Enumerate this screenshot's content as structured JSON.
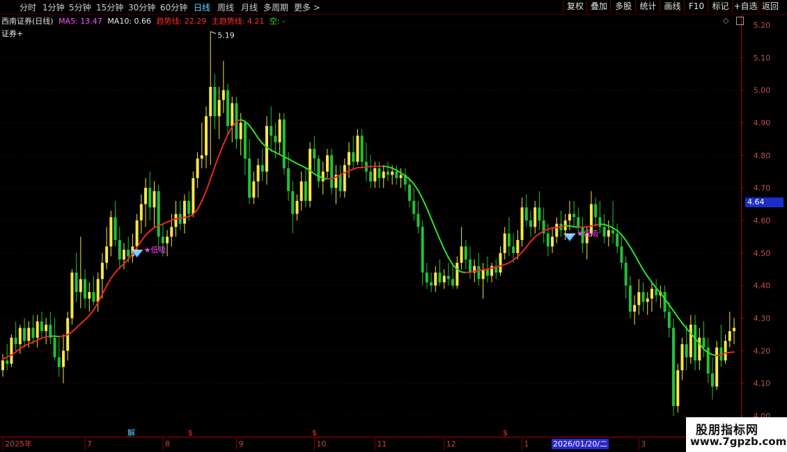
{
  "toolbar": {
    "tabs": [
      {
        "label": "分时"
      },
      {
        "label": "1分钟"
      },
      {
        "label": "5分钟"
      },
      {
        "label": "15分钟"
      },
      {
        "label": "30分钟"
      },
      {
        "label": "60分钟"
      },
      {
        "label": "日线",
        "active": true
      },
      {
        "label": "周线"
      },
      {
        "label": "月线"
      },
      {
        "label": "多周期"
      },
      {
        "label": "更多 >"
      }
    ],
    "right_buttons": [
      {
        "label": "复权"
      },
      {
        "label": "叠加"
      },
      {
        "label": "多股"
      },
      {
        "label": "统计"
      },
      {
        "label": "画线"
      },
      {
        "label": "F10"
      },
      {
        "label": "标记"
      },
      {
        "label": "+自选"
      },
      {
        "label": "返回"
      }
    ]
  },
  "info": {
    "title": "西南证券(日线)",
    "ma5": "MA5: 13.47",
    "ma10": "MA10: 0.66",
    "trend": "趋势线: 22.29",
    "main_trend": "主趋势线: 4.21",
    "empty": "空: -",
    "sublabel": "证券+"
  },
  "price_tag": "4.64",
  "date_box": "2026/01/20/二",
  "markers": {
    "jie": "解",
    "dollar": "$",
    "buy_label": "低吸",
    "high_label": "5.19"
  },
  "colors": {
    "bg": "#000000",
    "up": "#f5e64a",
    "down": "#22c038",
    "trend_up": "#e82828",
    "trend_down": "#30e030",
    "grid": "#6a0000",
    "accent": "#5fd7ff"
  },
  "watermark": {
    "line1": "股朋指标网",
    "line2": "www.7gpzb.com"
  },
  "chart_data": {
    "type": "candlestick",
    "y_axis": {
      "range": [
        4.0,
        5.2
      ],
      "ticks": [
        "5.20",
        "5.10",
        "5.00",
        "4.90",
        "4.80",
        "4.70",
        "4.60",
        "4.50",
        "4.40",
        "4.30",
        "4.20",
        "4.10",
        "4.00"
      ]
    },
    "x_axis": {
      "labels": [
        {
          "text": "2025年",
          "i": 0
        },
        {
          "text": "7",
          "i": 19
        },
        {
          "text": "8",
          "i": 37
        },
        {
          "text": "9",
          "i": 54
        },
        {
          "text": "10",
          "i": 72
        },
        {
          "text": "11",
          "i": 86
        },
        {
          "text": "12",
          "i": 102
        },
        {
          "text": "1",
          "i": 120
        },
        {
          "text": "3",
          "i": 147
        }
      ]
    },
    "annotations": [
      {
        "type": "high",
        "text": "5.19",
        "i": 48,
        "price": 5.18
      },
      {
        "type": "buy",
        "text": "低吸",
        "i": 31,
        "price": 4.5
      },
      {
        "type": "buy",
        "text": "低吸",
        "i": 131,
        "price": 4.55
      }
    ],
    "candles": [
      {
        "o": 4.14,
        "h": 4.19,
        "l": 4.12,
        "c": 4.17
      },
      {
        "o": 4.17,
        "h": 4.22,
        "l": 4.14,
        "c": 4.16
      },
      {
        "o": 4.16,
        "h": 4.25,
        "l": 4.15,
        "c": 4.24
      },
      {
        "o": 4.24,
        "h": 4.29,
        "l": 4.2,
        "c": 4.22
      },
      {
        "o": 4.22,
        "h": 4.28,
        "l": 4.19,
        "c": 4.27
      },
      {
        "o": 4.27,
        "h": 4.3,
        "l": 4.21,
        "c": 4.23
      },
      {
        "o": 4.23,
        "h": 4.29,
        "l": 4.21,
        "c": 4.27
      },
      {
        "o": 4.27,
        "h": 4.31,
        "l": 4.22,
        "c": 4.24
      },
      {
        "o": 4.24,
        "h": 4.31,
        "l": 4.21,
        "c": 4.29
      },
      {
        "o": 4.29,
        "h": 4.32,
        "l": 4.24,
        "c": 4.26
      },
      {
        "o": 4.26,
        "h": 4.3,
        "l": 4.22,
        "c": 4.28
      },
      {
        "o": 4.28,
        "h": 4.32,
        "l": 4.22,
        "c": 4.24
      },
      {
        "o": 4.24,
        "h": 4.3,
        "l": 4.17,
        "c": 4.18
      },
      {
        "o": 4.18,
        "h": 4.24,
        "l": 4.12,
        "c": 4.15
      },
      {
        "o": 4.15,
        "h": 4.25,
        "l": 4.1,
        "c": 4.2
      },
      {
        "o": 4.2,
        "h": 4.32,
        "l": 4.17,
        "c": 4.3
      },
      {
        "o": 4.3,
        "h": 4.45,
        "l": 4.28,
        "c": 4.44
      },
      {
        "o": 4.44,
        "h": 4.5,
        "l": 4.35,
        "c": 4.38
      },
      {
        "o": 4.38,
        "h": 4.55,
        "l": 4.33,
        "c": 4.42
      },
      {
        "o": 4.42,
        "h": 4.45,
        "l": 4.33,
        "c": 4.36
      },
      {
        "o": 4.36,
        "h": 4.41,
        "l": 4.32,
        "c": 4.38
      },
      {
        "o": 4.38,
        "h": 4.43,
        "l": 4.34,
        "c": 4.35
      },
      {
        "o": 4.35,
        "h": 4.44,
        "l": 4.32,
        "c": 4.42
      },
      {
        "o": 4.42,
        "h": 4.5,
        "l": 4.36,
        "c": 4.47
      },
      {
        "o": 4.47,
        "h": 4.58,
        "l": 4.45,
        "c": 4.52
      },
      {
        "o": 4.52,
        "h": 4.63,
        "l": 4.49,
        "c": 4.61
      },
      {
        "o": 4.61,
        "h": 4.66,
        "l": 4.52,
        "c": 4.54
      },
      {
        "o": 4.54,
        "h": 4.58,
        "l": 4.45,
        "c": 4.48
      },
      {
        "o": 4.48,
        "h": 4.53,
        "l": 4.45,
        "c": 4.51
      },
      {
        "o": 4.51,
        "h": 4.55,
        "l": 4.47,
        "c": 4.49
      },
      {
        "o": 4.49,
        "h": 4.56,
        "l": 4.47,
        "c": 4.52
      },
      {
        "o": 4.52,
        "h": 4.62,
        "l": 4.5,
        "c": 4.6
      },
      {
        "o": 4.6,
        "h": 4.68,
        "l": 4.56,
        "c": 4.65
      },
      {
        "o": 4.65,
        "h": 4.73,
        "l": 4.58,
        "c": 4.7
      },
      {
        "o": 4.7,
        "h": 4.75,
        "l": 4.6,
        "c": 4.64
      },
      {
        "o": 4.64,
        "h": 4.72,
        "l": 4.58,
        "c": 4.69
      },
      {
        "o": 4.69,
        "h": 4.71,
        "l": 4.51,
        "c": 4.55
      },
      {
        "o": 4.55,
        "h": 4.59,
        "l": 4.49,
        "c": 4.53
      },
      {
        "o": 4.53,
        "h": 4.57,
        "l": 4.49,
        "c": 4.55
      },
      {
        "o": 4.55,
        "h": 4.62,
        "l": 4.52,
        "c": 4.58
      },
      {
        "o": 4.58,
        "h": 4.66,
        "l": 4.55,
        "c": 4.62
      },
      {
        "o": 4.62,
        "h": 4.66,
        "l": 4.57,
        "c": 4.59
      },
      {
        "o": 4.59,
        "h": 4.68,
        "l": 4.56,
        "c": 4.66
      },
      {
        "o": 4.66,
        "h": 4.69,
        "l": 4.6,
        "c": 4.62
      },
      {
        "o": 4.62,
        "h": 4.75,
        "l": 4.61,
        "c": 4.73
      },
      {
        "o": 4.73,
        "h": 4.81,
        "l": 4.7,
        "c": 4.79
      },
      {
        "o": 4.79,
        "h": 4.9,
        "l": 4.76,
        "c": 4.8
      },
      {
        "o": 4.8,
        "h": 4.95,
        "l": 4.76,
        "c": 4.92
      },
      {
        "o": 4.92,
        "h": 5.18,
        "l": 4.77,
        "c": 5.01
      },
      {
        "o": 5.01,
        "h": 5.05,
        "l": 4.88,
        "c": 4.92
      },
      {
        "o": 4.92,
        "h": 5.01,
        "l": 4.85,
        "c": 4.97
      },
      {
        "o": 4.97,
        "h": 5.09,
        "l": 4.93,
        "c": 5.0
      },
      {
        "o": 5.0,
        "h": 5.02,
        "l": 4.86,
        "c": 4.89
      },
      {
        "o": 4.89,
        "h": 4.98,
        "l": 4.84,
        "c": 4.96
      },
      {
        "o": 4.96,
        "h": 4.98,
        "l": 4.82,
        "c": 4.85
      },
      {
        "o": 4.85,
        "h": 4.93,
        "l": 4.8,
        "c": 4.9
      },
      {
        "o": 4.9,
        "h": 4.91,
        "l": 4.74,
        "c": 4.79
      },
      {
        "o": 4.79,
        "h": 4.85,
        "l": 4.65,
        "c": 4.67
      },
      {
        "o": 4.67,
        "h": 4.75,
        "l": 4.65,
        "c": 4.72
      },
      {
        "o": 4.72,
        "h": 4.79,
        "l": 4.67,
        "c": 4.77
      },
      {
        "o": 4.77,
        "h": 4.82,
        "l": 4.72,
        "c": 4.75
      },
      {
        "o": 4.75,
        "h": 4.92,
        "l": 4.71,
        "c": 4.89
      },
      {
        "o": 4.89,
        "h": 4.95,
        "l": 4.81,
        "c": 4.86
      },
      {
        "o": 4.86,
        "h": 4.9,
        "l": 4.79,
        "c": 4.84
      },
      {
        "o": 4.84,
        "h": 4.93,
        "l": 4.8,
        "c": 4.91
      },
      {
        "o": 4.91,
        "h": 4.93,
        "l": 4.74,
        "c": 4.76
      },
      {
        "o": 4.76,
        "h": 4.81,
        "l": 4.66,
        "c": 4.69
      },
      {
        "o": 4.69,
        "h": 4.72,
        "l": 4.56,
        "c": 4.62
      },
      {
        "o": 4.62,
        "h": 4.68,
        "l": 4.6,
        "c": 4.66
      },
      {
        "o": 4.66,
        "h": 4.75,
        "l": 4.63,
        "c": 4.72
      },
      {
        "o": 4.72,
        "h": 4.76,
        "l": 4.64,
        "c": 4.66
      },
      {
        "o": 4.66,
        "h": 4.84,
        "l": 4.64,
        "c": 4.82
      },
      {
        "o": 4.82,
        "h": 4.86,
        "l": 4.75,
        "c": 4.79
      },
      {
        "o": 4.79,
        "h": 4.8,
        "l": 4.7,
        "c": 4.72
      },
      {
        "o": 4.72,
        "h": 4.78,
        "l": 4.68,
        "c": 4.75
      },
      {
        "o": 4.75,
        "h": 4.82,
        "l": 4.73,
        "c": 4.8
      },
      {
        "o": 4.8,
        "h": 4.82,
        "l": 4.68,
        "c": 4.7
      },
      {
        "o": 4.7,
        "h": 4.77,
        "l": 4.65,
        "c": 4.74
      },
      {
        "o": 4.74,
        "h": 4.77,
        "l": 4.67,
        "c": 4.69
      },
      {
        "o": 4.69,
        "h": 4.79,
        "l": 4.67,
        "c": 4.77
      },
      {
        "o": 4.77,
        "h": 4.84,
        "l": 4.73,
        "c": 4.81
      },
      {
        "o": 4.81,
        "h": 4.86,
        "l": 4.76,
        "c": 4.78
      },
      {
        "o": 4.78,
        "h": 4.88,
        "l": 4.77,
        "c": 4.86
      },
      {
        "o": 4.86,
        "h": 4.88,
        "l": 4.76,
        "c": 4.78
      },
      {
        "o": 4.78,
        "h": 4.84,
        "l": 4.72,
        "c": 4.75
      },
      {
        "o": 4.75,
        "h": 4.8,
        "l": 4.7,
        "c": 4.72
      },
      {
        "o": 4.72,
        "h": 4.78,
        "l": 4.7,
        "c": 4.76
      },
      {
        "o": 4.76,
        "h": 4.78,
        "l": 4.7,
        "c": 4.73
      },
      {
        "o": 4.73,
        "h": 4.77,
        "l": 4.7,
        "c": 4.75
      },
      {
        "o": 4.75,
        "h": 4.78,
        "l": 4.72,
        "c": 4.74
      },
      {
        "o": 4.74,
        "h": 4.77,
        "l": 4.71,
        "c": 4.75
      },
      {
        "o": 4.75,
        "h": 4.77,
        "l": 4.71,
        "c": 4.73
      },
      {
        "o": 4.73,
        "h": 4.76,
        "l": 4.7,
        "c": 4.74
      },
      {
        "o": 4.74,
        "h": 4.76,
        "l": 4.69,
        "c": 4.71
      },
      {
        "o": 4.71,
        "h": 4.73,
        "l": 4.64,
        "c": 4.66
      },
      {
        "o": 4.66,
        "h": 4.7,
        "l": 4.6,
        "c": 4.62
      },
      {
        "o": 4.62,
        "h": 4.66,
        "l": 4.56,
        "c": 4.58
      },
      {
        "o": 4.58,
        "h": 4.6,
        "l": 4.4,
        "c": 4.44
      },
      {
        "o": 4.44,
        "h": 4.47,
        "l": 4.39,
        "c": 4.41
      },
      {
        "o": 4.41,
        "h": 4.44,
        "l": 4.38,
        "c": 4.4
      },
      {
        "o": 4.4,
        "h": 4.46,
        "l": 4.38,
        "c": 4.44
      },
      {
        "o": 4.44,
        "h": 4.48,
        "l": 4.4,
        "c": 4.41
      },
      {
        "o": 4.41,
        "h": 4.45,
        "l": 4.39,
        "c": 4.43
      },
      {
        "o": 4.43,
        "h": 4.47,
        "l": 4.4,
        "c": 4.42
      },
      {
        "o": 4.42,
        "h": 4.46,
        "l": 4.39,
        "c": 4.4
      },
      {
        "o": 4.4,
        "h": 4.49,
        "l": 4.39,
        "c": 4.47
      },
      {
        "o": 4.47,
        "h": 4.58,
        "l": 4.45,
        "c": 4.52
      },
      {
        "o": 4.52,
        "h": 4.54,
        "l": 4.45,
        "c": 4.48
      },
      {
        "o": 4.48,
        "h": 4.52,
        "l": 4.42,
        "c": 4.44
      },
      {
        "o": 4.44,
        "h": 4.48,
        "l": 4.41,
        "c": 4.46
      },
      {
        "o": 4.46,
        "h": 4.5,
        "l": 4.4,
        "c": 4.42
      },
      {
        "o": 4.42,
        "h": 4.47,
        "l": 4.36,
        "c": 4.45
      },
      {
        "o": 4.45,
        "h": 4.49,
        "l": 4.41,
        "c": 4.43
      },
      {
        "o": 4.43,
        "h": 4.47,
        "l": 4.41,
        "c": 4.46
      },
      {
        "o": 4.46,
        "h": 4.48,
        "l": 4.42,
        "c": 4.44
      },
      {
        "o": 4.44,
        "h": 4.52,
        "l": 4.43,
        "c": 4.5
      },
      {
        "o": 4.5,
        "h": 4.58,
        "l": 4.48,
        "c": 4.56
      },
      {
        "o": 4.56,
        "h": 4.61,
        "l": 4.49,
        "c": 4.52
      },
      {
        "o": 4.52,
        "h": 4.56,
        "l": 4.47,
        "c": 4.5
      },
      {
        "o": 4.5,
        "h": 4.57,
        "l": 4.48,
        "c": 4.54
      },
      {
        "o": 4.54,
        "h": 4.67,
        "l": 4.52,
        "c": 4.64
      },
      {
        "o": 4.64,
        "h": 4.68,
        "l": 4.58,
        "c": 4.6
      },
      {
        "o": 4.6,
        "h": 4.63,
        "l": 4.55,
        "c": 4.58
      },
      {
        "o": 4.58,
        "h": 4.66,
        "l": 4.56,
        "c": 4.64
      },
      {
        "o": 4.64,
        "h": 4.69,
        "l": 4.57,
        "c": 4.6
      },
      {
        "o": 4.6,
        "h": 4.64,
        "l": 4.53,
        "c": 4.56
      },
      {
        "o": 4.56,
        "h": 4.59,
        "l": 4.49,
        "c": 4.52
      },
      {
        "o": 4.52,
        "h": 4.58,
        "l": 4.5,
        "c": 4.55
      },
      {
        "o": 4.55,
        "h": 4.61,
        "l": 4.53,
        "c": 4.59
      },
      {
        "o": 4.59,
        "h": 4.63,
        "l": 4.55,
        "c": 4.57
      },
      {
        "o": 4.57,
        "h": 4.62,
        "l": 4.54,
        "c": 4.6
      },
      {
        "o": 4.6,
        "h": 4.66,
        "l": 4.57,
        "c": 4.62
      },
      {
        "o": 4.62,
        "h": 4.66,
        "l": 4.58,
        "c": 4.61
      },
      {
        "o": 4.61,
        "h": 4.64,
        "l": 4.56,
        "c": 4.58
      },
      {
        "o": 4.58,
        "h": 4.61,
        "l": 4.5,
        "c": 4.53
      },
      {
        "o": 4.53,
        "h": 4.58,
        "l": 4.48,
        "c": 4.56
      },
      {
        "o": 4.56,
        "h": 4.69,
        "l": 4.55,
        "c": 4.65
      },
      {
        "o": 4.65,
        "h": 4.67,
        "l": 4.58,
        "c": 4.61
      },
      {
        "o": 4.61,
        "h": 4.66,
        "l": 4.56,
        "c": 4.58
      },
      {
        "o": 4.58,
        "h": 4.62,
        "l": 4.53,
        "c": 4.55
      },
      {
        "o": 4.55,
        "h": 4.6,
        "l": 4.52,
        "c": 4.57
      },
      {
        "o": 4.57,
        "h": 4.66,
        "l": 4.53,
        "c": 4.56
      },
      {
        "o": 4.56,
        "h": 4.59,
        "l": 4.5,
        "c": 4.52
      },
      {
        "o": 4.52,
        "h": 4.55,
        "l": 4.45,
        "c": 4.47
      },
      {
        "o": 4.47,
        "h": 4.49,
        "l": 4.36,
        "c": 4.4
      },
      {
        "o": 4.4,
        "h": 4.43,
        "l": 4.3,
        "c": 4.32
      },
      {
        "o": 4.32,
        "h": 4.37,
        "l": 4.28,
        "c": 4.34
      },
      {
        "o": 4.34,
        "h": 4.42,
        "l": 4.31,
        "c": 4.38
      },
      {
        "o": 4.38,
        "h": 4.41,
        "l": 4.32,
        "c": 4.35
      },
      {
        "o": 4.35,
        "h": 4.38,
        "l": 4.31,
        "c": 4.36
      },
      {
        "o": 4.36,
        "h": 4.41,
        "l": 4.32,
        "c": 4.39
      },
      {
        "o": 4.39,
        "h": 4.42,
        "l": 4.35,
        "c": 4.37
      },
      {
        "o": 4.37,
        "h": 4.4,
        "l": 4.33,
        "c": 4.38
      },
      {
        "o": 4.38,
        "h": 4.4,
        "l": 4.3,
        "c": 4.32
      },
      {
        "o": 4.32,
        "h": 4.35,
        "l": 4.24,
        "c": 4.27
      },
      {
        "o": 4.27,
        "h": 4.3,
        "l": 4.0,
        "c": 4.03
      },
      {
        "o": 4.03,
        "h": 4.16,
        "l": 4.01,
        "c": 4.14
      },
      {
        "o": 4.14,
        "h": 4.24,
        "l": 4.11,
        "c": 4.22
      },
      {
        "o": 4.22,
        "h": 4.28,
        "l": 4.14,
        "c": 4.18
      },
      {
        "o": 4.18,
        "h": 4.31,
        "l": 4.16,
        "c": 4.28
      },
      {
        "o": 4.28,
        "h": 4.31,
        "l": 4.14,
        "c": 4.17
      },
      {
        "o": 4.17,
        "h": 4.27,
        "l": 4.14,
        "c": 4.24
      },
      {
        "o": 4.24,
        "h": 4.29,
        "l": 4.18,
        "c": 4.21
      },
      {
        "o": 4.21,
        "h": 4.24,
        "l": 4.1,
        "c": 4.13
      },
      {
        "o": 4.13,
        "h": 4.18,
        "l": 4.05,
        "c": 4.09
      },
      {
        "o": 4.09,
        "h": 4.23,
        "l": 4.08,
        "c": 4.21
      },
      {
        "o": 4.21,
        "h": 4.28,
        "l": 4.15,
        "c": 4.17
      },
      {
        "o": 4.17,
        "h": 4.25,
        "l": 4.16,
        "c": 4.23
      },
      {
        "o": 4.23,
        "h": 4.32,
        "l": 4.21,
        "c": 4.26
      },
      {
        "o": 4.26,
        "h": 4.3,
        "l": 4.22,
        "c": 4.27
      }
    ]
  }
}
